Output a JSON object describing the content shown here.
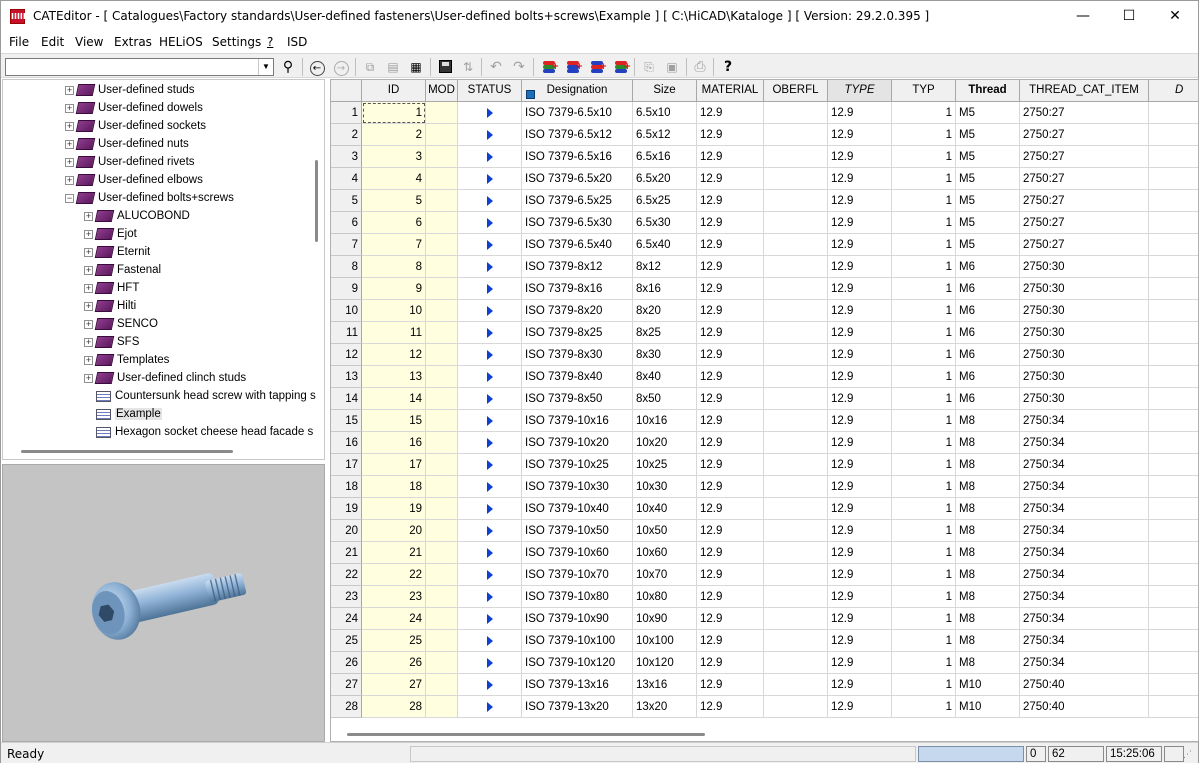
{
  "window": {
    "title": "CATEditor - [ Catalogues\\Factory standards\\User-defined fasteners\\User-defined bolts+screws\\Example ]      [ C:\\HiCAD\\Kataloge ]   [ Version: 29.2.0.395 ]",
    "app_icon_text": "IIIII",
    "minimize_glyph": "—",
    "maximize_glyph": "☐",
    "close_glyph": "✕"
  },
  "menu": [
    "File",
    "Edit",
    "View",
    "Extras",
    "HELiOS",
    "Settings",
    "?",
    "ISD"
  ],
  "toolbar": {
    "search_value": "",
    "dropdown_glyph": "▼",
    "buttons": {
      "find": "⚲",
      "back": "←",
      "forward": "→",
      "copy_rows": "⧉",
      "paste_doc": "▤",
      "new_table": "▦",
      "save": "",
      "sort": "⇅",
      "undo": "↶",
      "redo": "↷",
      "db1": "+",
      "db2": "+",
      "db3": "+",
      "db4": "+",
      "copy": "⎘",
      "paste": "▣",
      "print": "⎙",
      "help": "?"
    }
  },
  "tree": {
    "items": [
      {
        "label": "User-defined studs",
        "level": 0,
        "type": "book",
        "exp": "+"
      },
      {
        "label": "User-defined dowels",
        "level": 0,
        "type": "book",
        "exp": "+"
      },
      {
        "label": "User-defined sockets",
        "level": 0,
        "type": "book",
        "exp": "+"
      },
      {
        "label": "User-defined nuts",
        "level": 0,
        "type": "book",
        "exp": "+"
      },
      {
        "label": "User-defined rivets",
        "level": 0,
        "type": "book",
        "exp": "+"
      },
      {
        "label": "User-defined elbows",
        "level": 0,
        "type": "book",
        "exp": "+"
      },
      {
        "label": "User-defined bolts+screws",
        "level": 0,
        "type": "book",
        "exp": "−"
      },
      {
        "label": "ALUCOBOND",
        "level": 1,
        "type": "book",
        "exp": "+"
      },
      {
        "label": "Ejot",
        "level": 1,
        "type": "book",
        "exp": "+"
      },
      {
        "label": "Eternit",
        "level": 1,
        "type": "book",
        "exp": "+"
      },
      {
        "label": "Fastenal",
        "level": 1,
        "type": "book",
        "exp": "+"
      },
      {
        "label": "HFT",
        "level": 1,
        "type": "book",
        "exp": "+"
      },
      {
        "label": "Hilti",
        "level": 1,
        "type": "book",
        "exp": "+"
      },
      {
        "label": "SENCO",
        "level": 1,
        "type": "book",
        "exp": "+"
      },
      {
        "label": "SFS",
        "level": 1,
        "type": "book",
        "exp": "+"
      },
      {
        "label": "Templates",
        "level": 1,
        "type": "book",
        "exp": "+"
      },
      {
        "label": "User-defined clinch studs",
        "level": 1,
        "type": "book",
        "exp": "+"
      },
      {
        "label": "Countersunk head screw with tapping s",
        "level": 1,
        "type": "table",
        "exp": ""
      },
      {
        "label": "Example",
        "level": 1,
        "type": "table",
        "exp": "",
        "selected": true
      },
      {
        "label": "Hexagon socket cheese head facade s",
        "level": 1,
        "type": "table",
        "exp": ""
      }
    ]
  },
  "grid": {
    "columns": [
      "",
      "ID",
      "MOD",
      "STATUS",
      "Designation",
      "Size",
      "MATERIAL",
      "OBERFL",
      "TYPE",
      "TYP",
      "Thread",
      "THREAD_CAT_ITEM",
      "D"
    ],
    "rows": [
      {
        "n": "1",
        "id": "1",
        "mod": "",
        "des": "ISO 7379-6.5x10",
        "size": "6.5x10",
        "mat": "12.9",
        "ober": "",
        "type": "12.9",
        "typ": "1",
        "thr": "M5",
        "tci": "2750:27"
      },
      {
        "n": "2",
        "id": "2",
        "mod": "",
        "des": "ISO 7379-6.5x12",
        "size": "6.5x12",
        "mat": "12.9",
        "ober": "",
        "type": "12.9",
        "typ": "1",
        "thr": "M5",
        "tci": "2750:27"
      },
      {
        "n": "3",
        "id": "3",
        "mod": "",
        "des": "ISO 7379-6.5x16",
        "size": "6.5x16",
        "mat": "12.9",
        "ober": "",
        "type": "12.9",
        "typ": "1",
        "thr": "M5",
        "tci": "2750:27"
      },
      {
        "n": "4",
        "id": "4",
        "mod": "",
        "des": "ISO 7379-6.5x20",
        "size": "6.5x20",
        "mat": "12.9",
        "ober": "",
        "type": "12.9",
        "typ": "1",
        "thr": "M5",
        "tci": "2750:27"
      },
      {
        "n": "5",
        "id": "5",
        "mod": "",
        "des": "ISO 7379-6.5x25",
        "size": "6.5x25",
        "mat": "12.9",
        "ober": "",
        "type": "12.9",
        "typ": "1",
        "thr": "M5",
        "tci": "2750:27"
      },
      {
        "n": "6",
        "id": "6",
        "mod": "",
        "des": "ISO 7379-6.5x30",
        "size": "6.5x30",
        "mat": "12.9",
        "ober": "",
        "type": "12.9",
        "typ": "1",
        "thr": "M5",
        "tci": "2750:27"
      },
      {
        "n": "7",
        "id": "7",
        "mod": "",
        "des": "ISO 7379-6.5x40",
        "size": "6.5x40",
        "mat": "12.9",
        "ober": "",
        "type": "12.9",
        "typ": "1",
        "thr": "M5",
        "tci": "2750:27"
      },
      {
        "n": "8",
        "id": "8",
        "mod": "",
        "des": "ISO 7379-8x12",
        "size": "8x12",
        "mat": "12.9",
        "ober": "",
        "type": "12.9",
        "typ": "1",
        "thr": "M6",
        "tci": "2750:30"
      },
      {
        "n": "9",
        "id": "9",
        "mod": "",
        "des": "ISO 7379-8x16",
        "size": "8x16",
        "mat": "12.9",
        "ober": "",
        "type": "12.9",
        "typ": "1",
        "thr": "M6",
        "tci": "2750:30"
      },
      {
        "n": "10",
        "id": "10",
        "mod": "",
        "des": "ISO 7379-8x20",
        "size": "8x20",
        "mat": "12.9",
        "ober": "",
        "type": "12.9",
        "typ": "1",
        "thr": "M6",
        "tci": "2750:30"
      },
      {
        "n": "11",
        "id": "11",
        "mod": "",
        "des": "ISO 7379-8x25",
        "size": "8x25",
        "mat": "12.9",
        "ober": "",
        "type": "12.9",
        "typ": "1",
        "thr": "M6",
        "tci": "2750:30"
      },
      {
        "n": "12",
        "id": "12",
        "mod": "",
        "des": "ISO 7379-8x30",
        "size": "8x30",
        "mat": "12.9",
        "ober": "",
        "type": "12.9",
        "typ": "1",
        "thr": "M6",
        "tci": "2750:30"
      },
      {
        "n": "13",
        "id": "13",
        "mod": "",
        "des": "ISO 7379-8x40",
        "size": "8x40",
        "mat": "12.9",
        "ober": "",
        "type": "12.9",
        "typ": "1",
        "thr": "M6",
        "tci": "2750:30"
      },
      {
        "n": "14",
        "id": "14",
        "mod": "",
        "des": "ISO 7379-8x50",
        "size": "8x50",
        "mat": "12.9",
        "ober": "",
        "type": "12.9",
        "typ": "1",
        "thr": "M6",
        "tci": "2750:30"
      },
      {
        "n": "15",
        "id": "15",
        "mod": "",
        "des": "ISO 7379-10x16",
        "size": "10x16",
        "mat": "12.9",
        "ober": "",
        "type": "12.9",
        "typ": "1",
        "thr": "M8",
        "tci": "2750:34"
      },
      {
        "n": "16",
        "id": "16",
        "mod": "",
        "des": "ISO 7379-10x20",
        "size": "10x20",
        "mat": "12.9",
        "ober": "",
        "type": "12.9",
        "typ": "1",
        "thr": "M8",
        "tci": "2750:34"
      },
      {
        "n": "17",
        "id": "17",
        "mod": "",
        "des": "ISO 7379-10x25",
        "size": "10x25",
        "mat": "12.9",
        "ober": "",
        "type": "12.9",
        "typ": "1",
        "thr": "M8",
        "tci": "2750:34"
      },
      {
        "n": "18",
        "id": "18",
        "mod": "",
        "des": "ISO 7379-10x30",
        "size": "10x30",
        "mat": "12.9",
        "ober": "",
        "type": "12.9",
        "typ": "1",
        "thr": "M8",
        "tci": "2750:34"
      },
      {
        "n": "19",
        "id": "19",
        "mod": "",
        "des": "ISO 7379-10x40",
        "size": "10x40",
        "mat": "12.9",
        "ober": "",
        "type": "12.9",
        "typ": "1",
        "thr": "M8",
        "tci": "2750:34"
      },
      {
        "n": "20",
        "id": "20",
        "mod": "",
        "des": "ISO 7379-10x50",
        "size": "10x50",
        "mat": "12.9",
        "ober": "",
        "type": "12.9",
        "typ": "1",
        "thr": "M8",
        "tci": "2750:34"
      },
      {
        "n": "21",
        "id": "21",
        "mod": "",
        "des": "ISO 7379-10x60",
        "size": "10x60",
        "mat": "12.9",
        "ober": "",
        "type": "12.9",
        "typ": "1",
        "thr": "M8",
        "tci": "2750:34"
      },
      {
        "n": "22",
        "id": "22",
        "mod": "",
        "des": "ISO 7379-10x70",
        "size": "10x70",
        "mat": "12.9",
        "ober": "",
        "type": "12.9",
        "typ": "1",
        "thr": "M8",
        "tci": "2750:34"
      },
      {
        "n": "23",
        "id": "23",
        "mod": "",
        "des": "ISO 7379-10x80",
        "size": "10x80",
        "mat": "12.9",
        "ober": "",
        "type": "12.9",
        "typ": "1",
        "thr": "M8",
        "tci": "2750:34"
      },
      {
        "n": "24",
        "id": "24",
        "mod": "",
        "des": "ISO 7379-10x90",
        "size": "10x90",
        "mat": "12.9",
        "ober": "",
        "type": "12.9",
        "typ": "1",
        "thr": "M8",
        "tci": "2750:34"
      },
      {
        "n": "25",
        "id": "25",
        "mod": "",
        "des": "ISO 7379-10x100",
        "size": "10x100",
        "mat": "12.9",
        "ober": "",
        "type": "12.9",
        "typ": "1",
        "thr": "M8",
        "tci": "2750:34"
      },
      {
        "n": "26",
        "id": "26",
        "mod": "",
        "des": "ISO 7379-10x120",
        "size": "10x120",
        "mat": "12.9",
        "ober": "",
        "type": "12.9",
        "typ": "1",
        "thr": "M8",
        "tci": "2750:34"
      },
      {
        "n": "27",
        "id": "27",
        "mod": "",
        "des": "ISO 7379-13x16",
        "size": "13x16",
        "mat": "12.9",
        "ober": "",
        "type": "12.9",
        "typ": "1",
        "thr": "M10",
        "tci": "2750:40"
      },
      {
        "n": "28",
        "id": "28",
        "mod": "",
        "des": "ISO 7379-13x20",
        "size": "13x20",
        "mat": "12.9",
        "ober": "",
        "type": "12.9",
        "typ": "1",
        "thr": "M10",
        "tci": "2750:40"
      }
    ]
  },
  "statusbar": {
    "text": "Ready",
    "box1": "",
    "box2": "0",
    "box3": "62",
    "box4": "15:25:06",
    "box5": ""
  },
  "colors": {
    "id_mod_column_bg": "#ffffe0",
    "status_arrow": "#0b3fd6",
    "book_icon": "#7a2a7a",
    "preview_bg": "#c4c4c4",
    "bolt_color": "#7fa6cf"
  }
}
